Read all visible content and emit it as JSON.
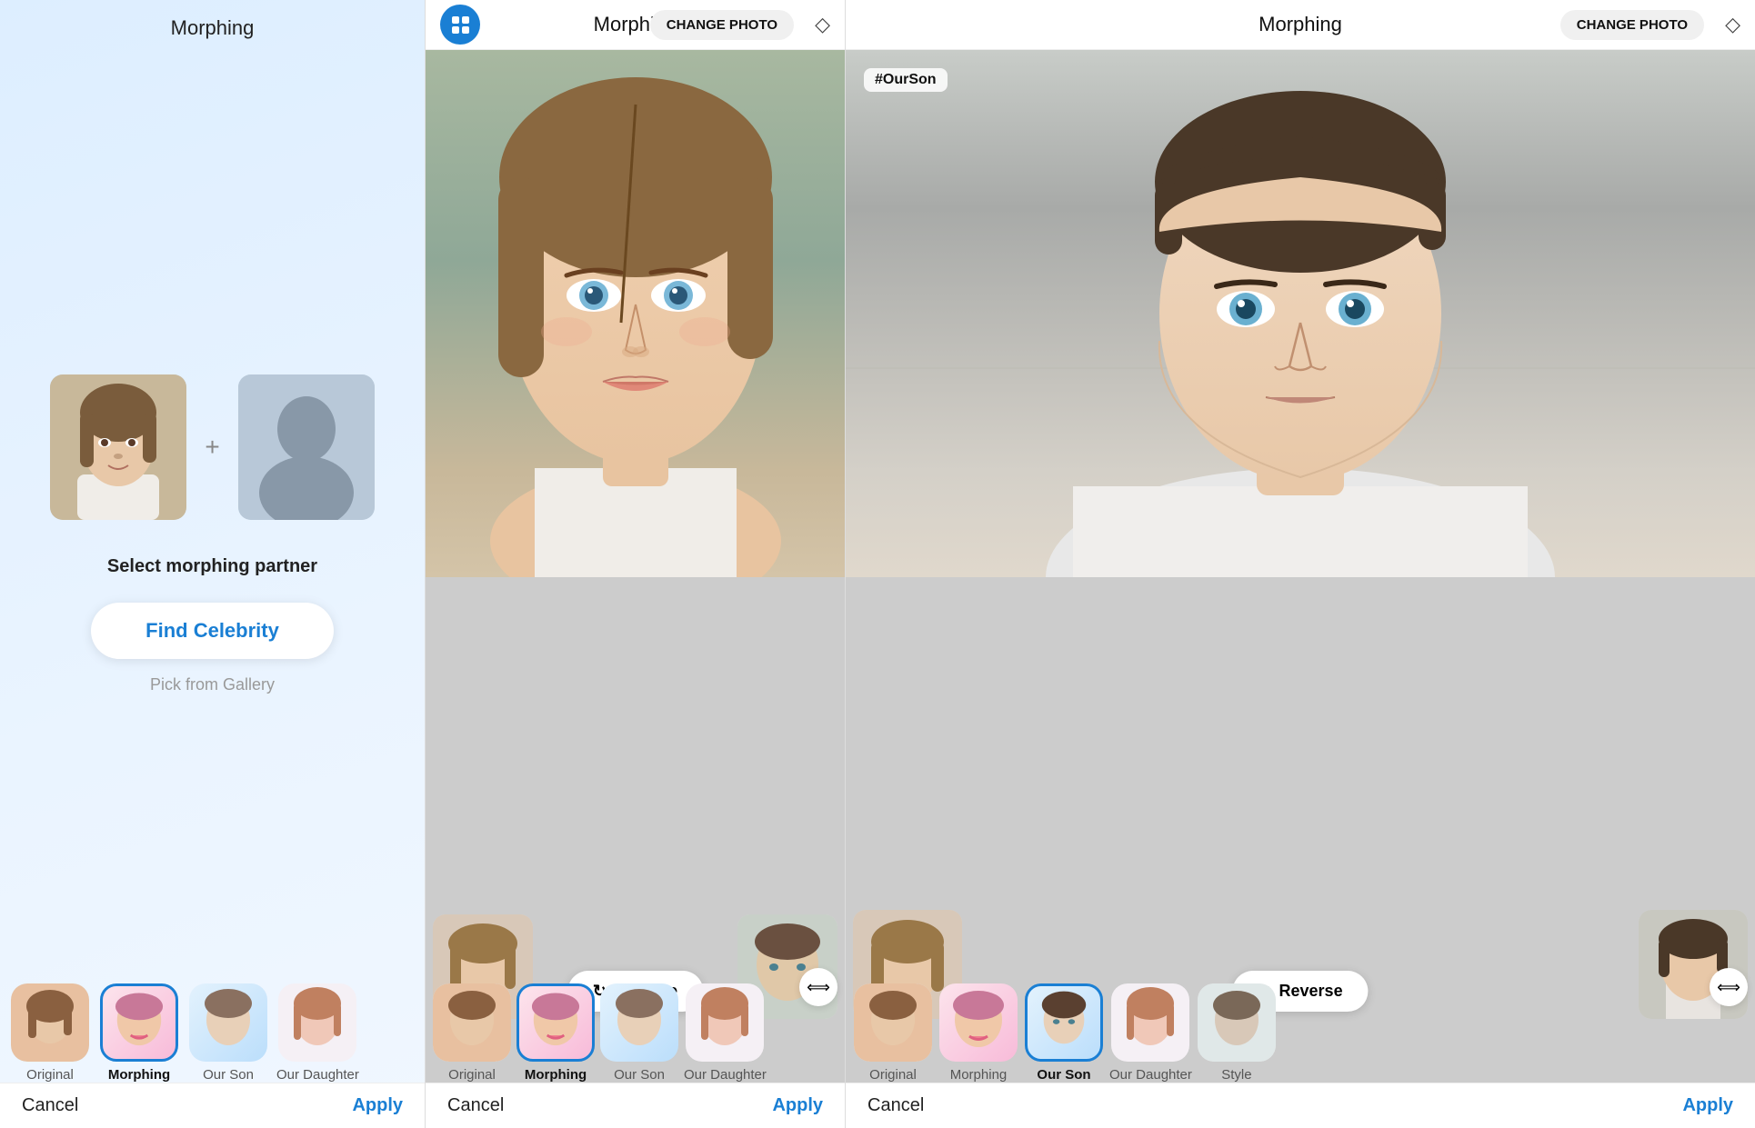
{
  "panel1": {
    "title": "Morphing",
    "select_label": "Select morphing partner",
    "find_celeb": "Find Celebrity",
    "pick_gallery": "Pick from Gallery",
    "cancel": "Cancel",
    "apply": "Apply",
    "tabs": [
      {
        "label": "Original",
        "selected": false,
        "bg": "plain"
      },
      {
        "label": "Morphing",
        "selected": true,
        "bg": "pink"
      },
      {
        "label": "Our Son",
        "selected": false,
        "bg": "blue"
      },
      {
        "label": "Our Daughter",
        "selected": false,
        "bg": "light"
      }
    ]
  },
  "panel2": {
    "title": "Morphing",
    "change_photo": "CHANGE PHOTO",
    "cancel": "Cancel",
    "apply": "Apply",
    "reverse": "Reverse",
    "hashtag": "",
    "tabs": [
      {
        "label": "Original",
        "selected": false,
        "bg": "plain"
      },
      {
        "label": "Morphing",
        "selected": true,
        "bg": "pink"
      },
      {
        "label": "Our Son",
        "selected": false,
        "bg": "blue"
      },
      {
        "label": "Our Daughter",
        "selected": false,
        "bg": "light"
      }
    ]
  },
  "panel3": {
    "title": "Morphing",
    "change_photo": "CHANGE PHOTO",
    "cancel": "Cancel",
    "apply": "Apply",
    "reverse": "Reverse",
    "hashtag": "#OurSon",
    "tabs": [
      {
        "label": "Original",
        "selected": false,
        "bg": "plain"
      },
      {
        "label": "Morphing",
        "selected": false,
        "bg": "pink"
      },
      {
        "label": "Our Son",
        "selected": true,
        "bg": "blue"
      },
      {
        "label": "Our Daughter",
        "selected": false,
        "bg": "light"
      },
      {
        "label": "Style",
        "selected": false,
        "bg": "plain"
      }
    ]
  },
  "icons": {
    "grid": "⊞",
    "eraser": "◇",
    "reverse": "↻",
    "expand": "⟺"
  }
}
